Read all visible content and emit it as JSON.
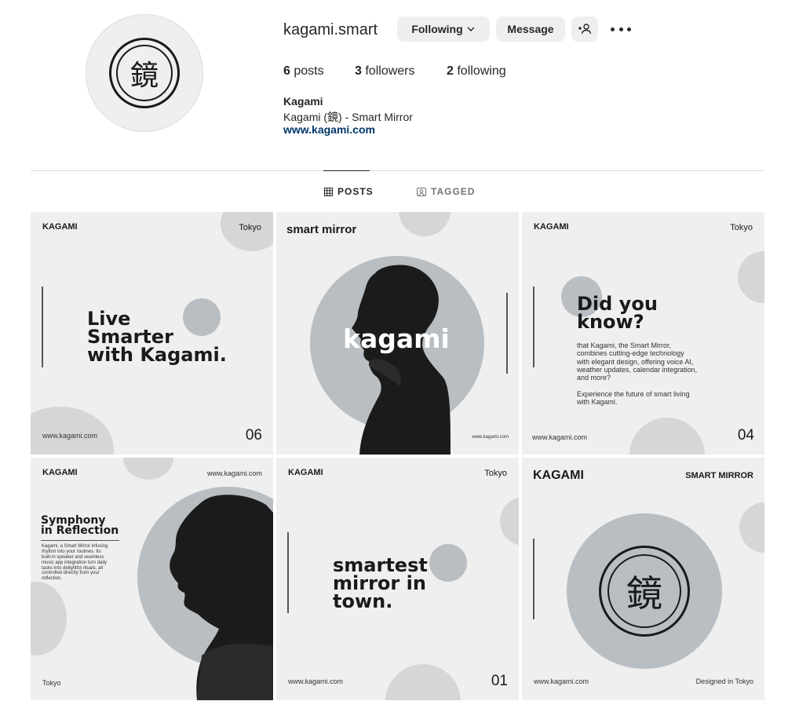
{
  "profile": {
    "username": "kagami.smart",
    "avatar_glyph": "鏡",
    "following_label": "Following",
    "message_label": "Message",
    "posts_count": "6",
    "posts_label": "posts",
    "followers_count": "3",
    "followers_label": "followers",
    "following_count": "2",
    "following_stat_label": "following",
    "full_name": "Kagami",
    "bio": "Kagami (鏡) - Smart Mirror",
    "website": "www.kagami.com"
  },
  "tabs": [
    {
      "label": "POSTS",
      "icon": "grid-icon",
      "active": true
    },
    {
      "label": "TAGGED",
      "icon": "tagged-icon",
      "active": false
    }
  ],
  "posts": {
    "p1": {
      "brand": "KAGAMI",
      "city": "Tokyo",
      "headline": [
        "Live",
        "Smarter",
        "with Kagami."
      ],
      "site": "www.kagami.com",
      "number": "06"
    },
    "p2": {
      "brand": "smart mirror",
      "headline": "kagami",
      "site": "www.kagami.com"
    },
    "p3": {
      "brand": "KAGAMI",
      "city": "Tokyo",
      "headline": [
        "Did you",
        "know?"
      ],
      "body": [
        "that Kagami, the Smart Mirror,",
        "combines cutting-edge technology",
        "with elegant design, offering voice AI,",
        "weather updates, calendar integration,",
        "and more?"
      ],
      "body2": [
        "Experience the future of smart living",
        "with Kagami."
      ],
      "site": "www.kagami.com",
      "number": "04"
    },
    "p4": {
      "brand": "KAGAMI",
      "site": "www.kagami.com",
      "headline": [
        "Symphony",
        "in Reflection"
      ],
      "body": [
        "Kagami, a Smart Mirror infusing",
        "rhythm into your routines. Its",
        "built-in speaker and seamless",
        "music app integration turn daily",
        "tasks into delightful rituals, all",
        "controlled directly from your",
        "reflection."
      ],
      "city": "Tokyo"
    },
    "p5": {
      "brand": "KAGAMI",
      "city": "Tokyo",
      "headline": [
        "smartest",
        "mirror in",
        "town."
      ],
      "site": "www.kagami.com",
      "number": "01"
    },
    "p6": {
      "brand": "KAGAMI",
      "tag": "SMART MIRROR",
      "glyph": "鏡",
      "site": "www.kagami.com",
      "footer": "Designed in Tokyo"
    }
  },
  "colors": {
    "link": "#00376b",
    "button_bg": "#efefef",
    "tile_bg": "#efefef",
    "accent_circle": "#b9bec3"
  }
}
